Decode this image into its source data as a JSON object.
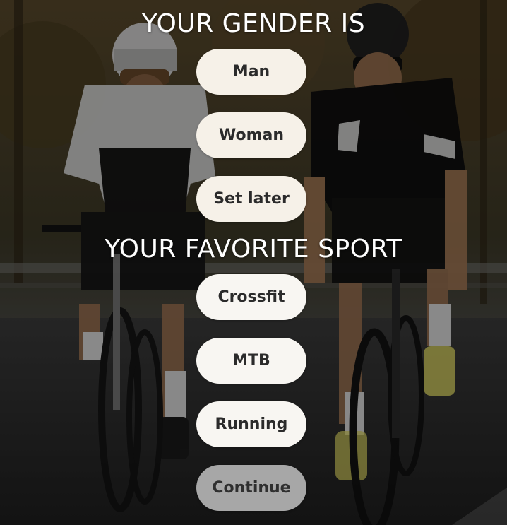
{
  "gender": {
    "heading": "YOUR GENDER IS",
    "options": [
      "Man",
      "Woman",
      "Set later"
    ]
  },
  "sport": {
    "heading": "YOUR FAVORITE SPORT",
    "options": [
      "Crossfit",
      "MTB",
      "Running"
    ]
  },
  "continue_label": "Continue",
  "colors": {
    "overlay": "#000000",
    "pill_background": "#f6f1e8",
    "pill_text": "#2b2b2b",
    "continue_disabled_background": "#a7a7a7"
  }
}
